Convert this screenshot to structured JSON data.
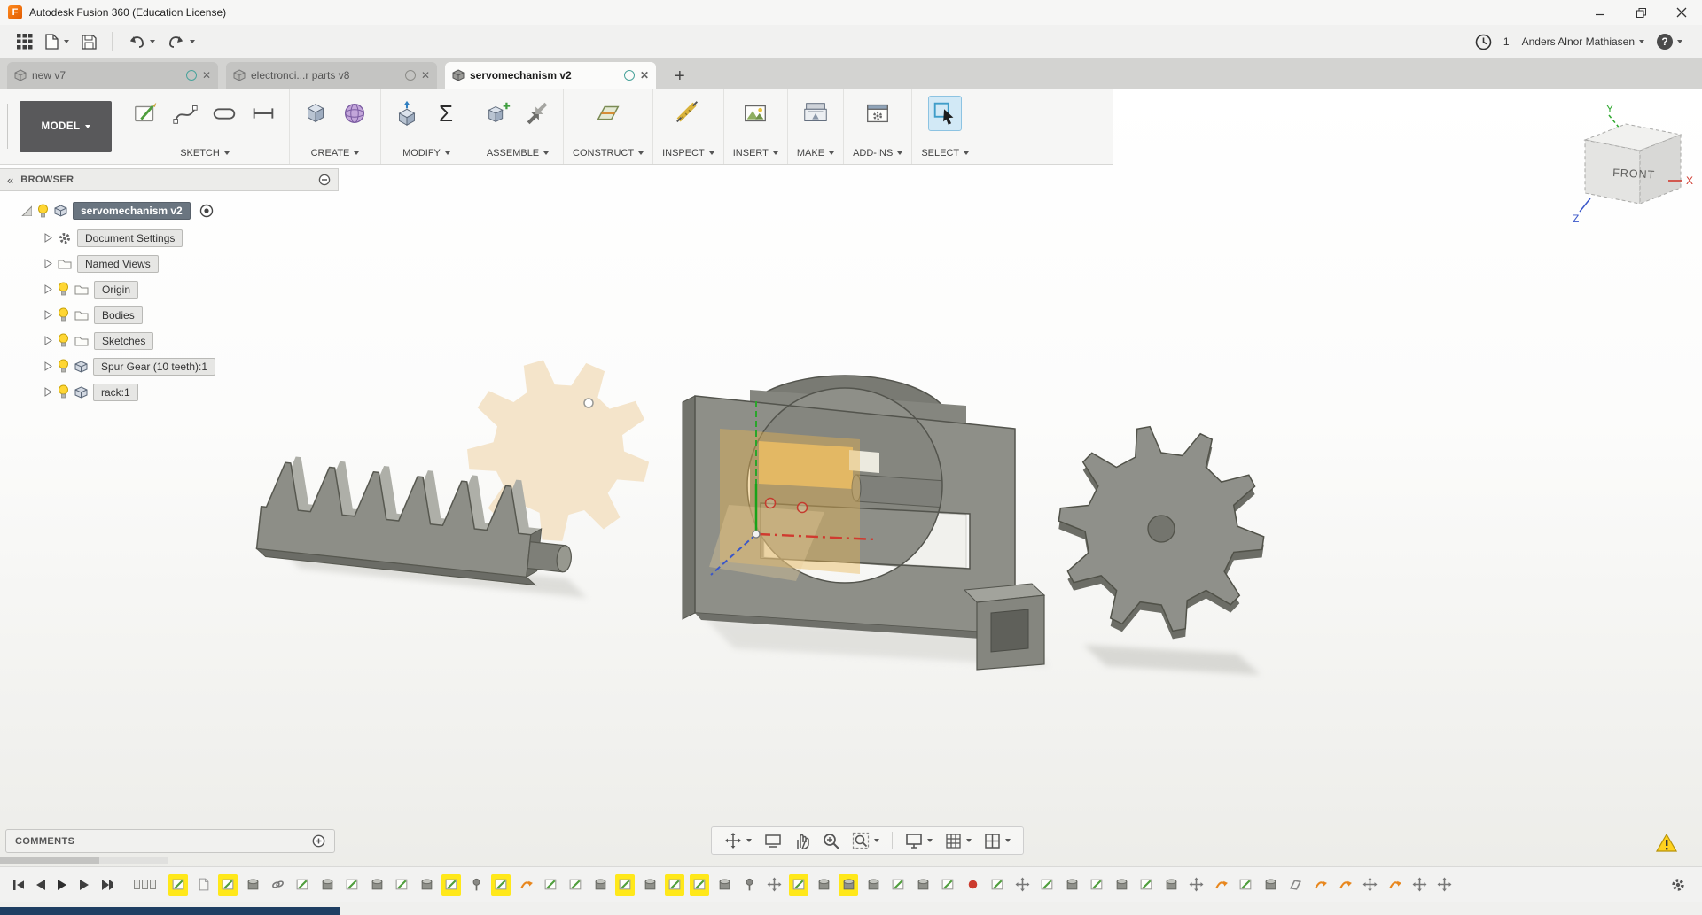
{
  "titlebar": {
    "title": "Autodesk Fusion 360 (Education License)"
  },
  "toolbar": {
    "job_count": "1",
    "user_name": "Anders Alnor Mathiasen",
    "help_label": "?"
  },
  "icons": {
    "collapse": "«",
    "plus": "+",
    "sigma": "Σ",
    "app_letter": "F"
  },
  "tabs": {
    "items": [
      {
        "label": "new v7"
      },
      {
        "label": "electronci...r parts v8"
      },
      {
        "label": "servomechanism v2"
      }
    ]
  },
  "ribbon": {
    "workspace_label": "MODEL",
    "groups": [
      {
        "label": "SKETCH"
      },
      {
        "label": "CREATE"
      },
      {
        "label": "MODIFY"
      },
      {
        "label": "ASSEMBLE"
      },
      {
        "label": "CONSTRUCT"
      },
      {
        "label": "INSPECT"
      },
      {
        "label": "INSERT"
      },
      {
        "label": "MAKE"
      },
      {
        "label": "ADD-INS"
      },
      {
        "label": "SELECT"
      }
    ]
  },
  "browser": {
    "header": "BROWSER",
    "root_label": "servomechanism v2",
    "items": [
      {
        "label": "Document Settings"
      },
      {
        "label": "Named Views"
      },
      {
        "label": "Origin"
      },
      {
        "label": "Bodies"
      },
      {
        "label": "Sketches"
      },
      {
        "label": "Spur Gear (10 teeth):1"
      },
      {
        "label": "rack:1"
      }
    ]
  },
  "viewcube": {
    "front_label": "FRONT",
    "axis_x": "X",
    "axis_y": "Y",
    "axis_z": "Z"
  },
  "comments": {
    "label": "COMMENTS"
  },
  "timeline": {
    "items": [
      {
        "t": "sketch",
        "h": true
      },
      {
        "t": "doc",
        "h": false
      },
      {
        "t": "sketch",
        "h": true
      },
      {
        "t": "extrude",
        "h": false
      },
      {
        "t": "link",
        "h": false
      },
      {
        "t": "sketch",
        "h": false
      },
      {
        "t": "extrude",
        "h": false
      },
      {
        "t": "sketch",
        "h": false
      },
      {
        "t": "extrude",
        "h": false
      },
      {
        "t": "sketch",
        "h": false
      },
      {
        "t": "extrude",
        "h": false
      },
      {
        "t": "sketch",
        "h": true
      },
      {
        "t": "pin",
        "h": false
      },
      {
        "t": "sketch",
        "h": true
      },
      {
        "t": "joint",
        "h": false
      },
      {
        "t": "sketch",
        "h": false
      },
      {
        "t": "sketch",
        "h": false
      },
      {
        "t": "extrude",
        "h": false
      },
      {
        "t": "sketch",
        "h": true
      },
      {
        "t": "extrude",
        "h": false
      },
      {
        "t": "sketch",
        "h": true
      },
      {
        "t": "sketch",
        "h": true
      },
      {
        "t": "extrude",
        "h": false
      },
      {
        "t": "pin",
        "h": false
      },
      {
        "t": "move",
        "h": false
      },
      {
        "t": "sketch",
        "h": true
      },
      {
        "t": "extrude",
        "h": false
      },
      {
        "t": "extrude",
        "h": true
      },
      {
        "t": "extrude",
        "h": false
      },
      {
        "t": "sketch",
        "h": false
      },
      {
        "t": "extrude",
        "h": false
      },
      {
        "t": "sketch",
        "h": false
      },
      {
        "t": "origin",
        "h": false
      },
      {
        "t": "sketch",
        "h": false
      },
      {
        "t": "move",
        "h": false
      },
      {
        "t": "sketch",
        "h": false
      },
      {
        "t": "extrude",
        "h": false
      },
      {
        "t": "sketch",
        "h": false
      },
      {
        "t": "extrude",
        "h": false
      },
      {
        "t": "sketch",
        "h": false
      },
      {
        "t": "extrude",
        "h": false
      },
      {
        "t": "move",
        "h": false
      },
      {
        "t": "joint",
        "h": false
      },
      {
        "t": "sketch",
        "h": false
      },
      {
        "t": "extrude",
        "h": false
      },
      {
        "t": "plane",
        "h": false
      },
      {
        "t": "joint",
        "h": false
      },
      {
        "t": "joint",
        "h": false
      },
      {
        "t": "move",
        "h": false
      },
      {
        "t": "joint",
        "h": false
      },
      {
        "t": "move",
        "h": false
      },
      {
        "t": "move",
        "h": false
      }
    ]
  },
  "colors": {
    "highlight_yellow": "#ffe81a",
    "select_blue": "#d2e9f6",
    "accent_orange": "#e8871e",
    "model_gray": "#8e8f88",
    "sketch_tan": "#f3e2c5",
    "sketch_orange": "#e9b54e"
  }
}
